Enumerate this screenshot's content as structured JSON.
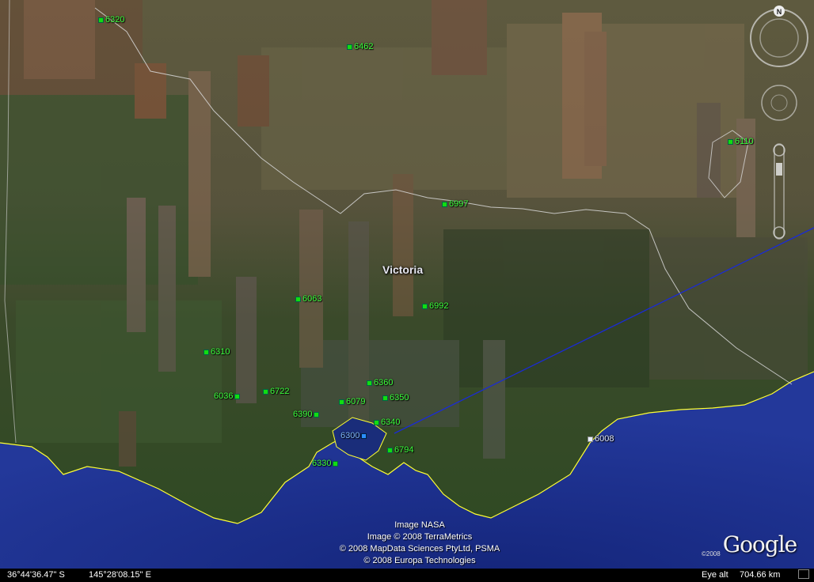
{
  "map": {
    "region_label": "Victoria",
    "markers": [
      {
        "id": "6320",
        "style": "green"
      },
      {
        "id": "6462",
        "style": "green"
      },
      {
        "id": "6110",
        "style": "green"
      },
      {
        "id": "6997",
        "style": "green"
      },
      {
        "id": "6063",
        "style": "green"
      },
      {
        "id": "6992",
        "style": "green"
      },
      {
        "id": "6310",
        "style": "green"
      },
      {
        "id": "6360",
        "style": "green"
      },
      {
        "id": "6722",
        "style": "green"
      },
      {
        "id": "6036",
        "style": "green"
      },
      {
        "id": "6079",
        "style": "green"
      },
      {
        "id": "6350",
        "style": "green"
      },
      {
        "id": "6390",
        "style": "green"
      },
      {
        "id": "6340",
        "style": "green"
      },
      {
        "id": "6300",
        "style": "selected"
      },
      {
        "id": "6794",
        "style": "green"
      },
      {
        "id": "6330",
        "style": "green"
      },
      {
        "id": "6008",
        "style": "white"
      }
    ],
    "colors": {
      "coast": "#ffff33",
      "sea": "#1a2f86",
      "path_line": "#1a2bd6",
      "marker": "#11dd11",
      "label": "#3dff3d"
    }
  },
  "attribution": {
    "line1": "Image NASA",
    "line2": "Image © 2008 TerraMetrics",
    "line3": "© 2008 MapData Sciences PtyLtd, PSMA",
    "line4": "© 2008 Europa Technologies"
  },
  "logo": {
    "copyright": "©2008",
    "text": "Google"
  },
  "status": {
    "latitude": "36°44'36.47\" S",
    "longitude": "145°28'08.15\" E",
    "eye_alt_label": "Eye alt",
    "eye_alt_value": "704.66 km"
  },
  "nav": {
    "north_label": "N",
    "icons": [
      "compass-ring-icon",
      "look-joystick-icon",
      "zoom-slider-icon"
    ]
  }
}
